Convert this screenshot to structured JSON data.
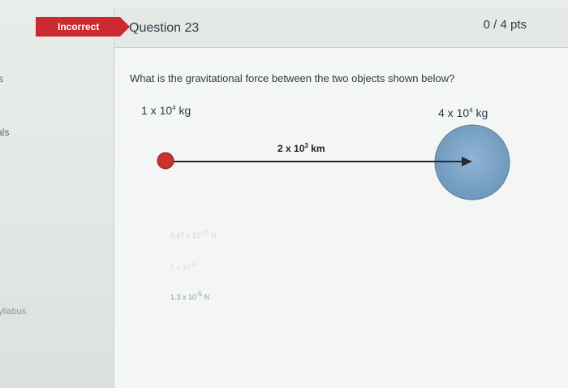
{
  "sidebar": {
    "fragments": [
      "s",
      "als",
      "yllabus"
    ]
  },
  "status": {
    "incorrect_label": "Incorrect",
    "color": "#cc2a2f"
  },
  "question": {
    "title": "Question 23",
    "points": "0 / 4 pts",
    "text": "What is the gravitational force between the two objects shown below?"
  },
  "diagram": {
    "mass1": {
      "coef": "1 x 10",
      "exp": "4",
      "unit": " kg"
    },
    "mass2": {
      "coef": "4 x 10",
      "exp": "4",
      "unit": " kg"
    },
    "distance": {
      "coef": "2 x 10",
      "exp": "3",
      "unit": " km"
    }
  },
  "answers": [
    {
      "coef": "6.67 x 10",
      "exp": "-11",
      "unit": " N"
    },
    {
      "coef": "1 x 10",
      "exp": "-4",
      "unit": ""
    },
    {
      "coef": "1.3 x 10",
      "exp": "-5",
      "unit": " N"
    }
  ]
}
